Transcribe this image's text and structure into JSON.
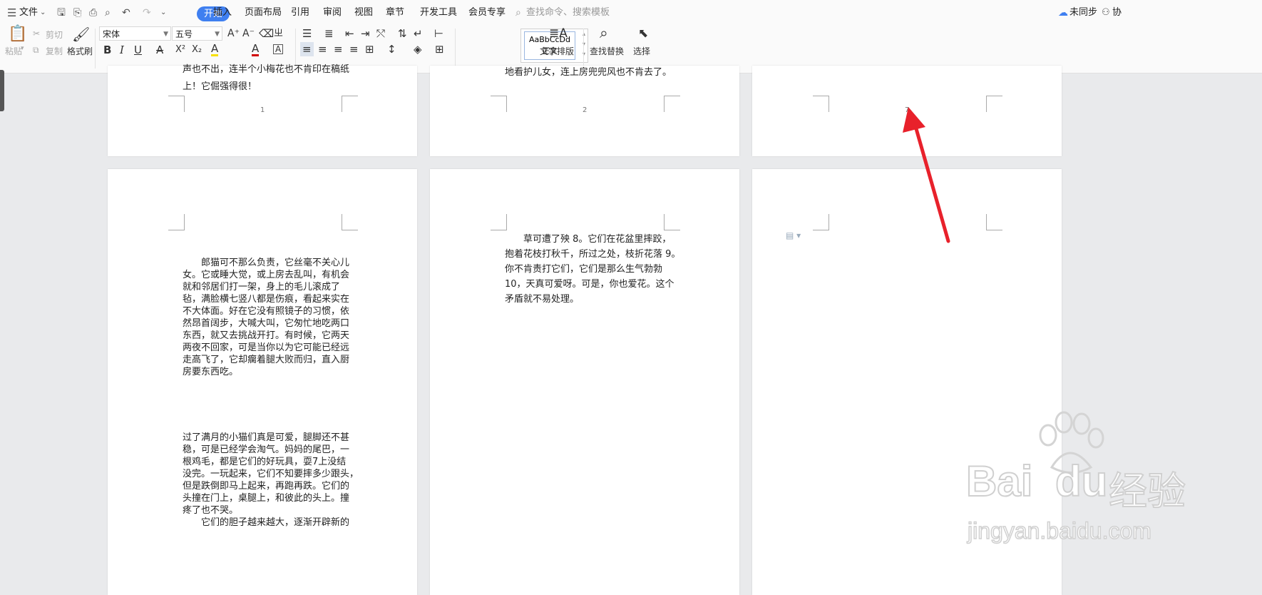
{
  "menubar": {
    "file_label": "文件",
    "tabs": [
      "开始",
      "插入",
      "页面布局",
      "引用",
      "审阅",
      "视图",
      "章节",
      "开发工具",
      "会员专享"
    ],
    "search_placeholder": "查找命令、搜索模板",
    "sync_label": "未同步",
    "collab_label": "协"
  },
  "ribbon": {
    "paste_label": "粘贴",
    "cut_label": "剪切",
    "copy_label": "复制",
    "format_painter_label": "格式刷",
    "font_name": "宋体",
    "font_size": "五号",
    "style_preview": "AaBbCcDd",
    "style_name": "正文",
    "text_layout_label": "文字排版",
    "find_replace_label": "查找替换",
    "select_label": "选择",
    "bold": "B",
    "italic": "I",
    "underline": "U",
    "strikethrough": "A",
    "superscript": "X²",
    "subscript": "X₂",
    "highlight": "A",
    "font_color": "A",
    "char_border": "A"
  },
  "pages": {
    "p1_top_lines": [
      "声也不出，连半个小梅花也不肯印在稿纸",
      "上！它倔强得很！"
    ],
    "p1_num": "1",
    "p2_top_lines": [
      "地看护儿女，连上房兜兜风也不肯去了。"
    ],
    "p2_num": "2",
    "p3_num": "7",
    "p4_para1": [
      "　　郎猫可不那么负责，它丝毫不关心儿",
      "女。它或睡大觉，或上房去乱叫，有机会",
      "就和邻居们打一架，身上的毛儿滚成了",
      "毡，满脸横七竖八都是伤痕，看起来实在",
      "不大体面。好在它没有照镜子的习惯，依",
      "然昂首阔步，大喊大叫，它匆忙地吃两口",
      "东西，就又去挑战开打。有时候，它两天",
      "两夜不回家，可是当你以为它可能已经远",
      "走高飞了，它却瘸着腿大败而归，直入厨",
      "房要东西吃。"
    ],
    "p4_para2": [
      "过了满月的小猫们真是可爱，腿脚还不甚",
      "稳，可是已经学会淘气。妈妈的尾巴，一",
      "根鸡毛，都是它们的好玩具，耍7上没结",
      "没完。一玩起来，它们不知要摔多少跟头，",
      "但是跌倒即马上起来，再跑再跌。它们的",
      "头撞在门上，桌腿上，和彼此的头上。撞",
      "疼了也不哭。"
    ],
    "p4_para3": [
      "　　它们的胆子越来越大，逐渐开辟新的"
    ],
    "p5_para": [
      "　　草可遭了殃 8。它们在花盆里摔跤，",
      "抱着花枝打秋千，所过之处，枝折花落 9。",
      "你不肯责打它们，它们是那么生气勃勃",
      "10，天真可爱呀。可是，你也爱花。这个",
      "矛盾就不易处理。"
    ]
  },
  "watermark": {
    "brand": "Bai",
    "brand2": "du",
    "cn": "经验",
    "url": "jingyan.baidu.com"
  },
  "colors": {
    "accent": "#3f7ff0",
    "arrow": "#e8212b"
  }
}
